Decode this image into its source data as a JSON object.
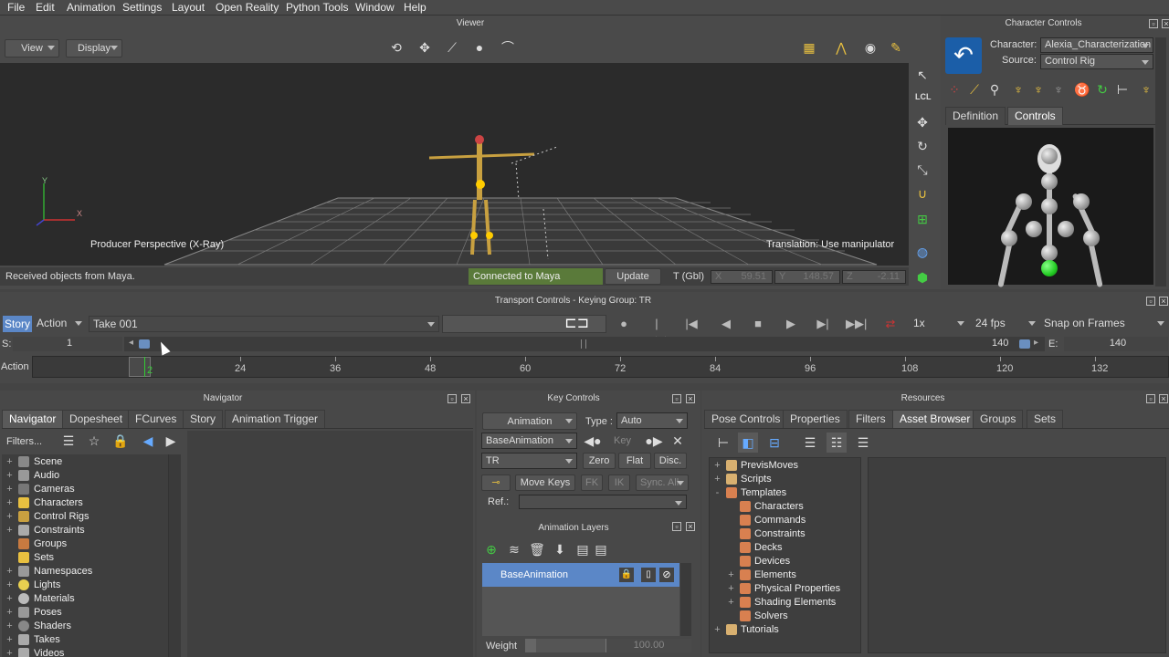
{
  "menu": [
    "File",
    "Edit",
    "Animation",
    "Settings",
    "Layout",
    "Open Reality",
    "Python Tools",
    "Window",
    "Help"
  ],
  "viewer": {
    "title": "Viewer",
    "view_btn": "View",
    "display_btn": "Display",
    "camera_label": "Producer Perspective (X-Ray)",
    "manip_label": "Translation: Use manipulator",
    "status": "Received objects from Maya.",
    "connected": "Connected to Maya",
    "update_btn": "Update",
    "coord_mode": "T (Gbl)",
    "x_label": "X",
    "x_val": "59.51",
    "y_label": "Y",
    "y_val": "148.57",
    "z_label": "Z",
    "z_val": "-2.11",
    "lcl": "LCL",
    "axis_x": "X",
    "axis_y": "Y"
  },
  "character_controls": {
    "title": "Character Controls",
    "character_label": "Character:",
    "character_value": "Alexia_Characterization",
    "source_label": "Source:",
    "source_value": "Control Rig",
    "tabs": [
      "Definition",
      "Controls"
    ],
    "active_tab": "Controls"
  },
  "transport": {
    "title": "Transport Controls  -  Keying Group: TR",
    "story_btn": "Story",
    "action_dd": "Action",
    "take": "Take 001",
    "speed": "1x",
    "fps": "24 fps",
    "snap": "Snap on Frames",
    "start_label": "S:",
    "start_val": "1",
    "slider_end": "140",
    "end_label": "E:",
    "end_val": "140",
    "timeline_label": "Action",
    "current_frame": "2",
    "ticks": [
      "24",
      "36",
      "48",
      "60",
      "72",
      "84",
      "96",
      "108",
      "120",
      "132"
    ]
  },
  "navigator": {
    "title": "Navigator",
    "tabs": [
      "Navigator",
      "Dopesheet",
      "FCurves",
      "Story",
      "Animation Trigger"
    ],
    "filters": "Filters...",
    "items": [
      "Scene",
      "Audio",
      "Cameras",
      "Characters",
      "Control Rigs",
      "Constraints",
      "Groups",
      "Sets",
      "Namespaces",
      "Lights",
      "Materials",
      "Poses",
      "Shaders",
      "Takes",
      "Videos"
    ]
  },
  "key_controls": {
    "title": "Key Controls",
    "animation_dd": "Animation",
    "type_label": "Type :",
    "type_val": "Auto",
    "layer_dd": "BaseAnimation",
    "key_label": "Key",
    "set_dd": "TR",
    "zero": "Zero",
    "flat": "Flat",
    "disc": "Disc.",
    "move_keys": "Move Keys",
    "fk": "FK",
    "ik": "IK",
    "sync_all": "Sync. All",
    "ref_label": "Ref.:",
    "layers_title": "Animation Layers",
    "layer_name": "BaseAnimation",
    "weight_label": "Weight",
    "weight_val": "100.00"
  },
  "resources": {
    "title": "Resources",
    "tabs": [
      "Pose Controls",
      "Properties",
      "Filters",
      "Asset Browser",
      "Groups",
      "Sets"
    ],
    "active_tab": "Asset Browser",
    "tree": [
      {
        "label": "PrevisMoves",
        "level": 0,
        "expander": "+"
      },
      {
        "label": "Scripts",
        "level": 0,
        "expander": "+"
      },
      {
        "label": "Templates",
        "level": 0,
        "expander": "-"
      },
      {
        "label": "Characters",
        "level": 1,
        "expander": ""
      },
      {
        "label": "Commands",
        "level": 1,
        "expander": ""
      },
      {
        "label": "Constraints",
        "level": 1,
        "expander": ""
      },
      {
        "label": "Decks",
        "level": 1,
        "expander": ""
      },
      {
        "label": "Devices",
        "level": 1,
        "expander": ""
      },
      {
        "label": "Elements",
        "level": 1,
        "expander": "+"
      },
      {
        "label": "Physical Properties",
        "level": 1,
        "expander": "+"
      },
      {
        "label": "Shading Elements",
        "level": 1,
        "expander": "+"
      },
      {
        "label": "Solvers",
        "level": 1,
        "expander": ""
      },
      {
        "label": "Tutorials",
        "level": 0,
        "expander": "+"
      }
    ]
  },
  "colors": {
    "accent": "#4a7bb5",
    "connected": "#5a7a3a",
    "layer_bg": "#5b87c7"
  }
}
